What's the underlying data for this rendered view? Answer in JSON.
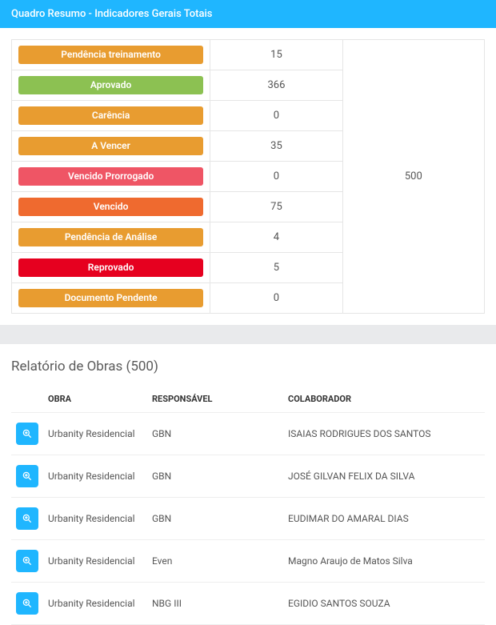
{
  "panel": {
    "title": "Quadro Resumo - Indicadores Gerais Totais",
    "total": 500,
    "rows": [
      {
        "label": "Pendência treinamento",
        "value": 15,
        "color": "#e89c30"
      },
      {
        "label": "Aprovado",
        "value": 366,
        "color": "#8cc152"
      },
      {
        "label": "Carência",
        "value": 0,
        "color": "#e89c30"
      },
      {
        "label": "A Vencer",
        "value": 35,
        "color": "#e89c30"
      },
      {
        "label": "Vencido Prorrogado",
        "value": 0,
        "color": "#ef5565"
      },
      {
        "label": "Vencido",
        "value": 75,
        "color": "#ef6a2f"
      },
      {
        "label": "Pendência de Análise",
        "value": 4,
        "color": "#e89c30"
      },
      {
        "label": "Reprovado",
        "value": 5,
        "color": "#e6001f"
      },
      {
        "label": "Documento Pendente",
        "value": 0,
        "color": "#e89c30"
      }
    ]
  },
  "report": {
    "title": "Relatório de Obras (500)",
    "columns": {
      "obra": "OBRA",
      "responsavel": "RESPONSÁVEL",
      "colaborador": "COLABORADOR"
    },
    "rows": [
      {
        "obra": "Urbanity Residencial",
        "responsavel": "GBN",
        "colaborador": "ISAIAS RODRIGUES DOS SANTOS"
      },
      {
        "obra": "Urbanity Residencial",
        "responsavel": "GBN",
        "colaborador": "JOSÉ GILVAN FELIX DA SILVA"
      },
      {
        "obra": "Urbanity Residencial",
        "responsavel": "GBN",
        "colaborador": "EUDIMAR DO AMARAL DIAS"
      },
      {
        "obra": "Urbanity Residencial",
        "responsavel": "Even",
        "colaborador": "Magno Araujo de Matos Silva"
      },
      {
        "obra": "Urbanity Residencial",
        "responsavel": "NBG III",
        "colaborador": "EGIDIO SANTOS SOUZA"
      }
    ]
  }
}
